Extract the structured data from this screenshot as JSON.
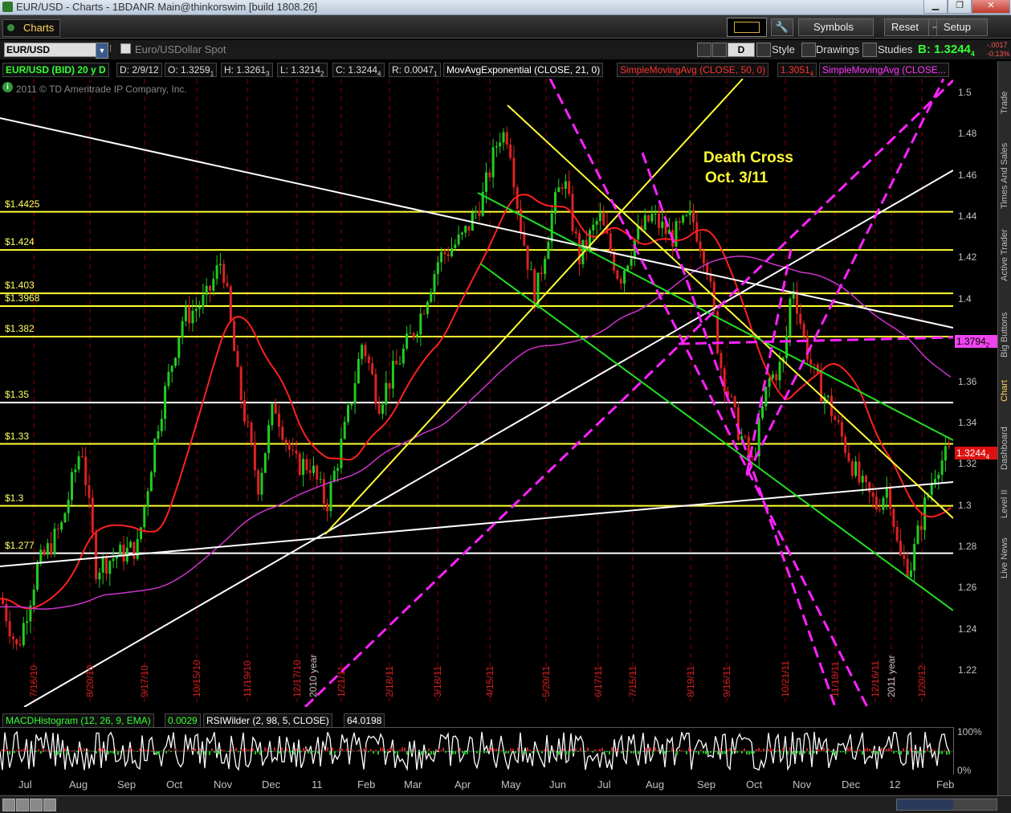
{
  "window": {
    "title": "EUR/USD - Charts - 1BDANR Main@thinkorswim [build 1808.26]"
  },
  "toolbar": {
    "tab_label": "Charts",
    "symbols_label": "Symbols",
    "reset_label": "Reset",
    "setup_label": "Setup"
  },
  "symbol": {
    "value": "EUR/USD",
    "description": "Euro/USDollar Spot",
    "bid_label": "B: 1.3244",
    "bid_sub": "4",
    "change_top": "-.0017",
    "change_bottom": "-0.13%"
  },
  "chart_controls": {
    "period_button": "D",
    "style_label": "Style",
    "drawings_label": "Drawings",
    "studies_label": "Studies"
  },
  "header": {
    "symbol_period": "EUR/USD (BID) 20 y D",
    "date": "D: 2/9/12",
    "open": "O: 1.3259",
    "open_sub": "1",
    "high": "H: 1.3261",
    "high_sub": "3",
    "low": "L: 1.3214",
    "low_sub": "2",
    "close": "C: 1.3244",
    "close_sub": "4",
    "range": "R: 0.0047",
    "range_sub": "1",
    "ema_label": "MovAvgExponential (CLOSE, 21, 0)",
    "sma50_label": "SimpleMovingAvg (CLOSE, 50, 0)",
    "sma50_value": "1.3051",
    "sma50_sub": "4",
    "sma200_label": "SimpleMovingAvg (CLOSE...",
    "copyright": "2011 © TD Ameritrade IP Company, Inc."
  },
  "annotation": {
    "line1": "Death Cross",
    "line2": "Oct. 3/11"
  },
  "level_labels": [
    "$1.4425",
    "$1.424",
    "$1.403",
    "$1.3968",
    "$1.382",
    "$1.35",
    "$1.33",
    "$1.3",
    "$1.277"
  ],
  "price_axis": [
    "1.5",
    "1.48",
    "1.46",
    "1.44",
    "1.42",
    "1.4",
    "1.38",
    "1.36",
    "1.34",
    "1.32",
    "1.3",
    "1.28",
    "1.26",
    "1.24",
    "1.22"
  ],
  "price_badges": {
    "sma200": "1.3794",
    "sma200_sub": "2",
    "last": "1.3244",
    "last_sub": "4"
  },
  "date_markers": [
    "7/16/10",
    "8/20/10",
    "9/17/10",
    "10/15/10",
    "11/19/10",
    "12/17/10",
    "2010 year",
    "1/21/11",
    "2/18/11",
    "3/18/11",
    "4/15/11",
    "5/20/11",
    "6/17/11",
    "7/15/11",
    "8/19/11",
    "9/16/11",
    "10/21/11",
    "11/18/11",
    "12/16/11",
    "2011 year",
    "1/20/12"
  ],
  "lower": {
    "macd_label": "MACDHistogram (12, 26, 9, EMA)",
    "macd_value": "0.0029",
    "rsi_label": "RSIWilder (2, 98, 5, CLOSE)",
    "rsi_value": "64.0198",
    "scale_top": "100%",
    "scale_bottom": "0%"
  },
  "months": [
    "Jul",
    "Aug",
    "Sep",
    "Oct",
    "Nov",
    "Dec",
    "11",
    "Feb",
    "Mar",
    "Apr",
    "May",
    "Jun",
    "Jul",
    "Aug",
    "Sep",
    "Oct",
    "Nov",
    "Dec",
    "12",
    "Feb"
  ],
  "side_tabs": [
    "Trade",
    "Times And Sales",
    "Active Trader",
    "Big Buttons",
    "Chart",
    "Dashboard",
    "Level II",
    "Live News"
  ],
  "colors": {
    "candle_up": "#22cc22",
    "candle_down": "#dd2222",
    "ema": "#ff2020",
    "sma": "#cc33cc",
    "level": "#ffff33",
    "trend_white": "#ffffff",
    "trend_green": "#22dd22",
    "trend_magenta": "#ff22ff"
  }
}
